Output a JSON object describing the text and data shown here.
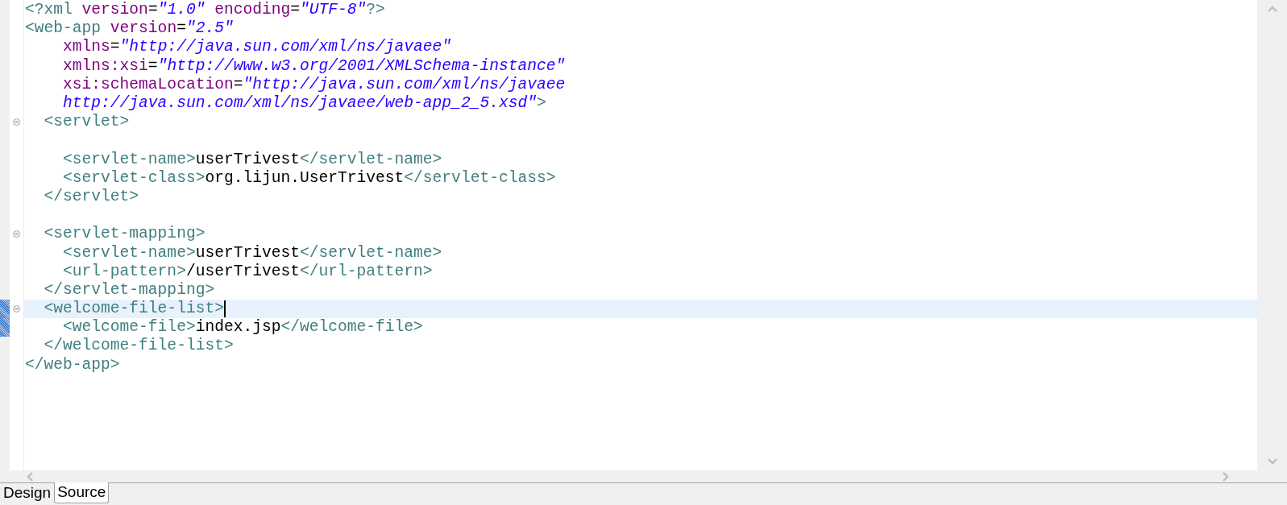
{
  "editor": {
    "lines": [
      {
        "selected": false,
        "foldable": false,
        "marked": false,
        "tokens": [
          {
            "kind": "tag",
            "text": "<?xml "
          },
          {
            "kind": "attr",
            "text": "version"
          },
          {
            "kind": "eq",
            "text": "="
          },
          {
            "kind": "value",
            "text": "\"1.0\""
          },
          {
            "kind": "attr",
            "text": " encoding"
          },
          {
            "kind": "eq",
            "text": "="
          },
          {
            "kind": "value",
            "text": "\"UTF-8\""
          },
          {
            "kind": "tag",
            "text": "?>"
          }
        ]
      },
      {
        "selected": false,
        "foldable": false,
        "marked": false,
        "tokens": [
          {
            "kind": "tag",
            "text": "<web-app "
          },
          {
            "kind": "attr",
            "text": "version"
          },
          {
            "kind": "eq",
            "text": "="
          },
          {
            "kind": "value",
            "text": "\"2.5\""
          }
        ]
      },
      {
        "selected": false,
        "foldable": false,
        "marked": false,
        "tokens": [
          {
            "kind": "attr",
            "text": "    xmlns"
          },
          {
            "kind": "eq",
            "text": "="
          },
          {
            "kind": "value",
            "text": "\"http://java.sun.com/xml/ns/javaee\""
          }
        ]
      },
      {
        "selected": false,
        "foldable": false,
        "marked": false,
        "tokens": [
          {
            "kind": "attr",
            "text": "    xmlns:xsi"
          },
          {
            "kind": "eq",
            "text": "="
          },
          {
            "kind": "value",
            "text": "\"http://www.w3.org/2001/XMLSchema-instance\""
          }
        ]
      },
      {
        "selected": false,
        "foldable": false,
        "marked": false,
        "tokens": [
          {
            "kind": "attr",
            "text": "    xsi:schemaLocation"
          },
          {
            "kind": "eq",
            "text": "="
          },
          {
            "kind": "value",
            "text": "\"http://java.sun.com/xml/ns/javaee"
          }
        ]
      },
      {
        "selected": false,
        "foldable": false,
        "marked": false,
        "tokens": [
          {
            "kind": "value",
            "text": "    http://java.sun.com/xml/ns/javaee/web-app_2_5.xsd\""
          },
          {
            "kind": "tag",
            "text": ">"
          }
        ]
      },
      {
        "selected": false,
        "foldable": true,
        "marked": false,
        "tokens": [
          {
            "kind": "tag",
            "text": "  <servlet>"
          }
        ]
      },
      {
        "selected": false,
        "foldable": false,
        "marked": false
      },
      {
        "selected": false,
        "foldable": false,
        "marked": false,
        "tokens": [
          {
            "kind": "tag",
            "text": "    <servlet-name>"
          },
          {
            "kind": "content",
            "text": "userTrivest"
          },
          {
            "kind": "tag",
            "text": "</servlet-name>"
          }
        ]
      },
      {
        "selected": false,
        "foldable": false,
        "marked": false,
        "tokens": [
          {
            "kind": "tag",
            "text": "    <servlet-class>"
          },
          {
            "kind": "content",
            "text": "org.lijun.UserTrivest"
          },
          {
            "kind": "tag",
            "text": "</servlet-class>"
          }
        ]
      },
      {
        "selected": false,
        "foldable": false,
        "marked": false,
        "tokens": [
          {
            "kind": "tag",
            "text": "  </servlet>"
          }
        ]
      },
      {
        "selected": false,
        "foldable": false,
        "marked": false
      },
      {
        "selected": false,
        "foldable": true,
        "marked": false,
        "tokens": [
          {
            "kind": "tag",
            "text": "  <servlet-mapping>"
          }
        ]
      },
      {
        "selected": false,
        "foldable": false,
        "marked": false,
        "tokens": [
          {
            "kind": "tag",
            "text": "    <servlet-name>"
          },
          {
            "kind": "content",
            "text": "userTrivest"
          },
          {
            "kind": "tag",
            "text": "</servlet-name>"
          }
        ]
      },
      {
        "selected": false,
        "foldable": false,
        "marked": false,
        "tokens": [
          {
            "kind": "tag",
            "text": "    <url-pattern>"
          },
          {
            "kind": "content",
            "text": "/userTrivest"
          },
          {
            "kind": "tag",
            "text": "</url-pattern>"
          }
        ]
      },
      {
        "selected": false,
        "foldable": false,
        "marked": false,
        "tokens": [
          {
            "kind": "tag",
            "text": "  </servlet-mapping>"
          }
        ]
      },
      {
        "selected": true,
        "foldable": true,
        "marked": true,
        "tokens": [
          {
            "kind": "tag",
            "text": "  <welcome-file-list>"
          }
        ]
      },
      {
        "selected": false,
        "foldable": false,
        "marked": true,
        "tokens": [
          {
            "kind": "tag",
            "text": "    <welcome-file>"
          },
          {
            "kind": "content",
            "text": "index.jsp"
          },
          {
            "kind": "tag",
            "text": "</welcome-file>"
          }
        ]
      },
      {
        "selected": false,
        "foldable": false,
        "marked": false,
        "tokens": [
          {
            "kind": "tag",
            "text": "  </welcome-file-list>"
          }
        ]
      },
      {
        "selected": false,
        "foldable": false,
        "marked": false,
        "tokens": [
          {
            "kind": "tag",
            "text": "</web-app>"
          }
        ]
      }
    ]
  },
  "tabs": [
    {
      "label": "Design",
      "selected": false
    },
    {
      "label": "Source",
      "selected": true
    }
  ]
}
